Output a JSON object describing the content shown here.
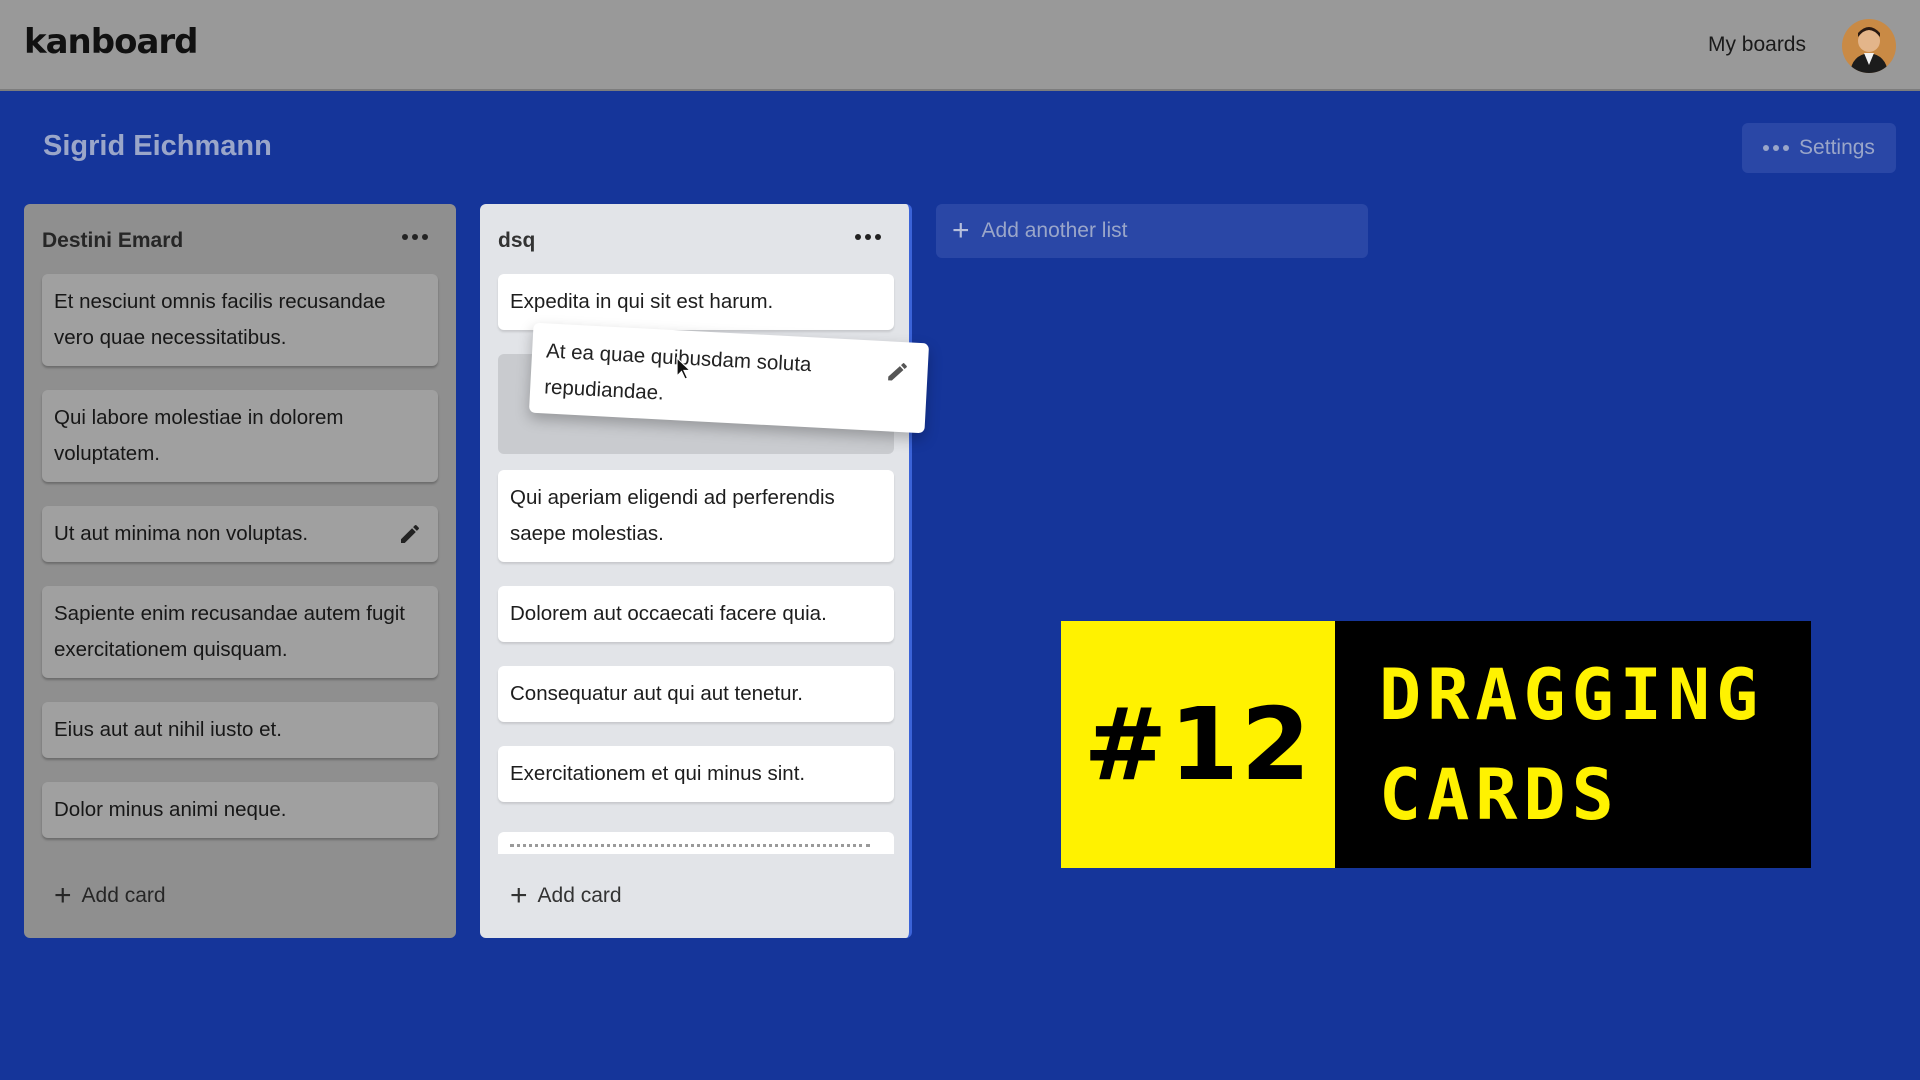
{
  "app": {
    "logo": "kanboard",
    "nav_link": "My boards"
  },
  "board": {
    "title": "Sigrid Eichmann",
    "settings_label": "Settings",
    "add_list_label": "Add another list"
  },
  "lists": [
    {
      "title": "Destini Emard",
      "add_card_label": "Add card",
      "cards": [
        "Et nesciunt omnis facilis recusandae vero quae necessitatibus.",
        "Qui labore molestiae in dolorem voluptatem.",
        "Ut aut minima non voluptas.",
        "Sapiente enim recusandae autem fugit exercitationem quisquam.",
        "Eius aut aut nihil iusto et.",
        "Dolor minus animi neque."
      ]
    },
    {
      "title": "dsq",
      "add_card_label": "Add card",
      "cards": [
        "Expedita in qui sit est harum.",
        "Qui aperiam eligendi ad perferendis saepe molestias.",
        "Dolorem aut occaecati facere quia.",
        "Consequatur aut qui aut tenetur.",
        "Exercitationem et qui minus sint."
      ]
    }
  ],
  "dragging_card": "At ea quae quibusdam soluta repudiandae.",
  "banner": {
    "number": "#12",
    "line1": "DRAGGING",
    "line2": "CARDS"
  },
  "colors": {
    "board_bg": "#15359a",
    "banner_yellow": "#fff200",
    "banner_black": "#000000"
  },
  "icons": {
    "list_menu": "more-horizontal-icon",
    "edit": "pencil-icon",
    "add": "plus-icon",
    "cursor": "mouse-pointer-icon"
  }
}
